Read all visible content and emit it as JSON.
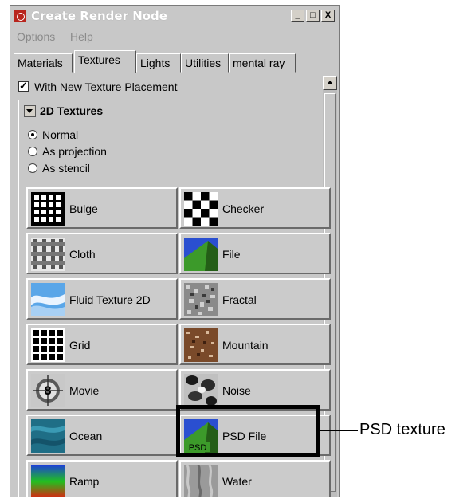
{
  "window": {
    "title": "Create Render Node",
    "buttons": [
      "_",
      "□",
      "X"
    ]
  },
  "menubar": {
    "items": [
      "Options",
      "Help"
    ]
  },
  "tabs": [
    "Materials",
    "Textures",
    "Lights",
    "Utilities",
    "mental ray"
  ],
  "active_tab": "Textures",
  "placement_checkbox": {
    "label": "With New Texture Placement",
    "checked": true
  },
  "section": {
    "title": "2D Textures",
    "expanded": true
  },
  "mode_options": [
    {
      "label": "Normal",
      "selected": true
    },
    {
      "label": "As projection",
      "selected": false
    },
    {
      "label": "As stencil",
      "selected": false
    }
  ],
  "textures": [
    {
      "label": "Bulge",
      "icon": "bulge-icon"
    },
    {
      "label": "Checker",
      "icon": "checker-icon"
    },
    {
      "label": "Cloth",
      "icon": "cloth-icon"
    },
    {
      "label": "File",
      "icon": "file-icon"
    },
    {
      "label": "Fluid Texture 2D",
      "icon": "fluid-texture-icon"
    },
    {
      "label": "Fractal",
      "icon": "fractal-icon"
    },
    {
      "label": "Grid",
      "icon": "grid-icon"
    },
    {
      "label": "Mountain",
      "icon": "mountain-icon"
    },
    {
      "label": "Movie",
      "icon": "movie-icon"
    },
    {
      "label": "Noise",
      "icon": "noise-icon"
    },
    {
      "label": "Ocean",
      "icon": "ocean-icon"
    },
    {
      "label": "PSD File",
      "icon": "psd-file-icon",
      "icon_text": "PSD"
    },
    {
      "label": "Ramp",
      "icon": "ramp-icon"
    },
    {
      "label": "Water",
      "icon": "water-icon"
    }
  ],
  "callout": {
    "label": "PSD texture"
  },
  "colors": {
    "window_bg": "#c8c8c8",
    "highlight": "#000000"
  }
}
